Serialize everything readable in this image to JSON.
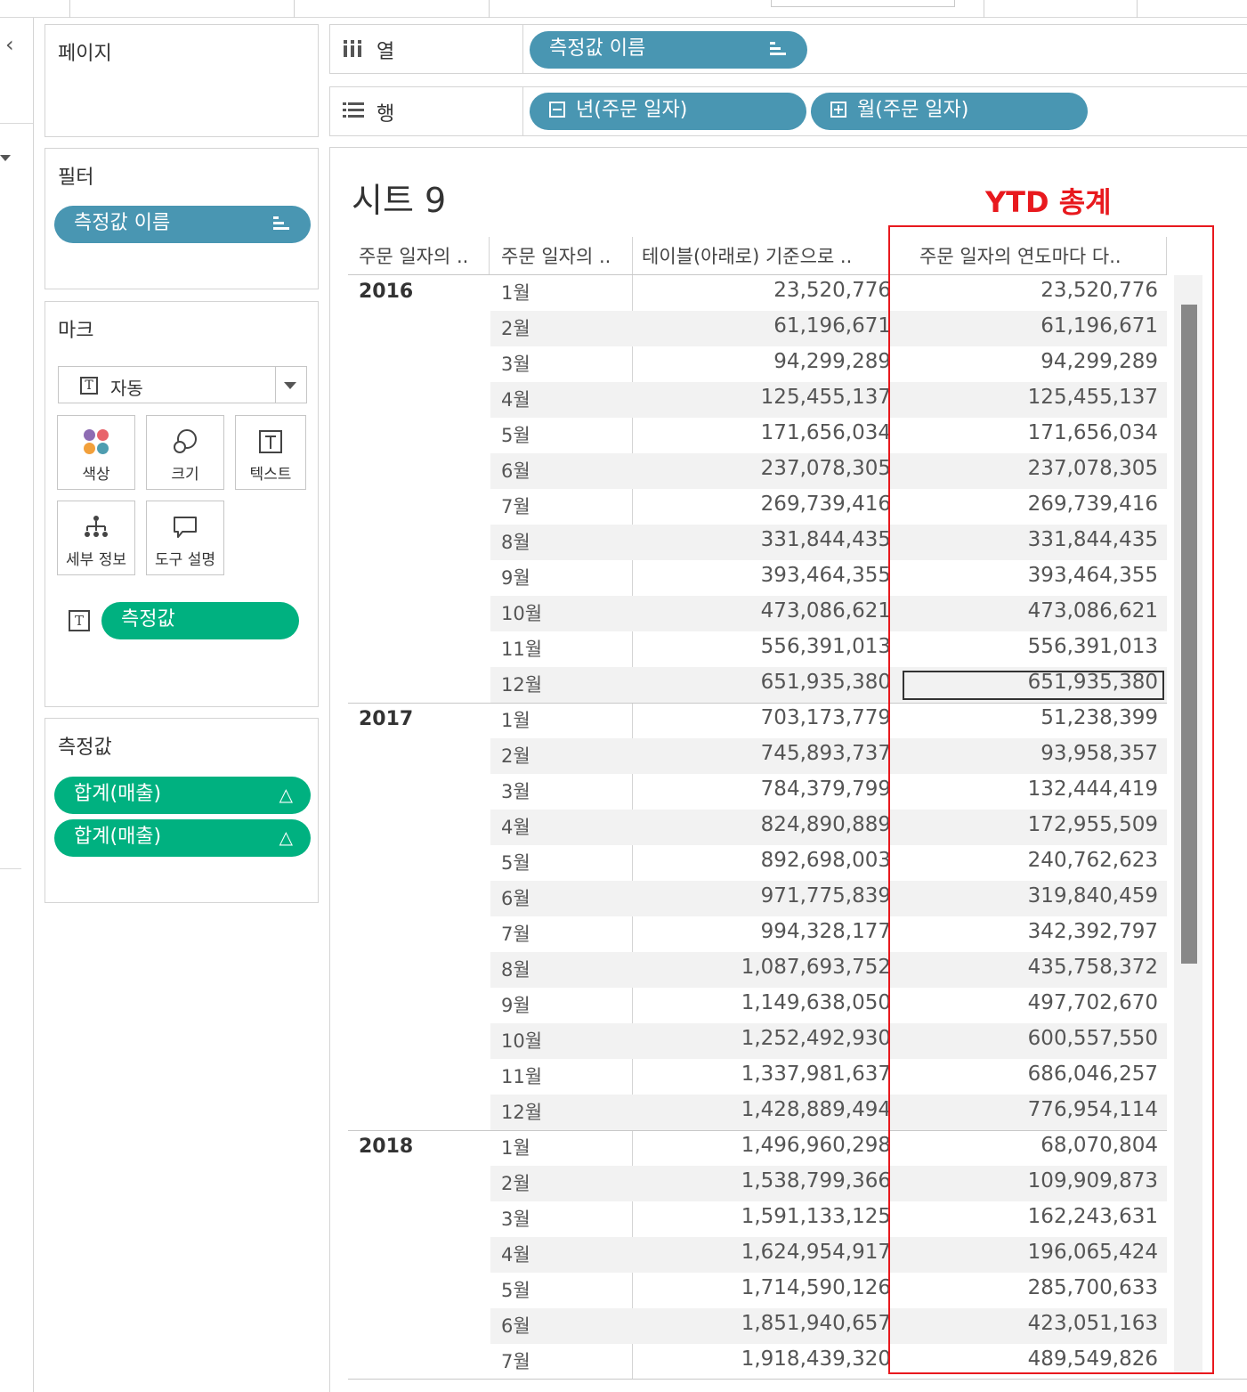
{
  "panels": {
    "pages": {
      "title": "페이지"
    },
    "filters": {
      "title": "필터",
      "pill": "측정값 이름"
    },
    "marks": {
      "title": "마크",
      "mark_type": "자동",
      "buttons": {
        "color": "색상",
        "size": "크기",
        "text": "텍스트",
        "detail": "세부 정보",
        "tooltip": "도구 설명"
      },
      "text_pill": "측정값"
    },
    "measure_values": {
      "title": "측정값",
      "pills": [
        "합계(매출)",
        "합계(매출)"
      ],
      "delta_symbol": "△"
    }
  },
  "shelves": {
    "columns": {
      "label": "열",
      "pills": [
        "측정값 이름"
      ]
    },
    "rows": {
      "label": "행",
      "pills": [
        "년(주문 일자)",
        "월(주문 일자)"
      ]
    }
  },
  "view": {
    "sheet_title": "시트 9",
    "annotation": "YTD 총계",
    "column_headers": [
      "주문 일자의 ..",
      "주문 일자의 ..",
      "테이블(아래로) 기준으로 ..",
      "주문 일자의 연도마다 다.."
    ]
  },
  "years": [
    {
      "year": "2016",
      "rows": [
        {
          "month": "1월",
          "running_total": "23,520,776",
          "ytd_total": "23,520,776"
        },
        {
          "month": "2월",
          "running_total": "61,196,671",
          "ytd_total": "61,196,671"
        },
        {
          "month": "3월",
          "running_total": "94,299,289",
          "ytd_total": "94,299,289"
        },
        {
          "month": "4월",
          "running_total": "125,455,137",
          "ytd_total": "125,455,137"
        },
        {
          "month": "5월",
          "running_total": "171,656,034",
          "ytd_total": "171,656,034"
        },
        {
          "month": "6월",
          "running_total": "237,078,305",
          "ytd_total": "237,078,305"
        },
        {
          "month": "7월",
          "running_total": "269,739,416",
          "ytd_total": "269,739,416"
        },
        {
          "month": "8월",
          "running_total": "331,844,435",
          "ytd_total": "331,844,435"
        },
        {
          "month": "9월",
          "running_total": "393,464,355",
          "ytd_total": "393,464,355"
        },
        {
          "month": "10월",
          "running_total": "473,086,621",
          "ytd_total": "473,086,621"
        },
        {
          "month": "11월",
          "running_total": "556,391,013",
          "ytd_total": "556,391,013"
        },
        {
          "month": "12월",
          "running_total": "651,935,380",
          "ytd_total": "651,935,380",
          "selected": true
        }
      ]
    },
    {
      "year": "2017",
      "rows": [
        {
          "month": "1월",
          "running_total": "703,173,779",
          "ytd_total": "51,238,399"
        },
        {
          "month": "2월",
          "running_total": "745,893,737",
          "ytd_total": "93,958,357"
        },
        {
          "month": "3월",
          "running_total": "784,379,799",
          "ytd_total": "132,444,419"
        },
        {
          "month": "4월",
          "running_total": "824,890,889",
          "ytd_total": "172,955,509"
        },
        {
          "month": "5월",
          "running_total": "892,698,003",
          "ytd_total": "240,762,623"
        },
        {
          "month": "6월",
          "running_total": "971,775,839",
          "ytd_total": "319,840,459"
        },
        {
          "month": "7월",
          "running_total": "994,328,177",
          "ytd_total": "342,392,797"
        },
        {
          "month": "8월",
          "running_total": "1,087,693,752",
          "ytd_total": "435,758,372"
        },
        {
          "month": "9월",
          "running_total": "1,149,638,050",
          "ytd_total": "497,702,670"
        },
        {
          "month": "10월",
          "running_total": "1,252,492,930",
          "ytd_total": "600,557,550"
        },
        {
          "month": "11월",
          "running_total": "1,337,981,637",
          "ytd_total": "686,046,257"
        },
        {
          "month": "12월",
          "running_total": "1,428,889,494",
          "ytd_total": "776,954,114"
        }
      ]
    },
    {
      "year": "2018",
      "rows": [
        {
          "month": "1월",
          "running_total": "1,496,960,298",
          "ytd_total": "68,070,804"
        },
        {
          "month": "2월",
          "running_total": "1,538,799,366",
          "ytd_total": "109,909,873"
        },
        {
          "month": "3월",
          "running_total": "1,591,133,125",
          "ytd_total": "162,243,631"
        },
        {
          "month": "4월",
          "running_total": "1,624,954,917",
          "ytd_total": "196,065,424"
        },
        {
          "month": "5월",
          "running_total": "1,714,590,126",
          "ytd_total": "285,700,633"
        },
        {
          "month": "6월",
          "running_total": "1,851,940,657",
          "ytd_total": "423,051,163"
        },
        {
          "month": "7월",
          "running_total": "1,918,439,320",
          "ytd_total": "489,549,826"
        }
      ]
    }
  ],
  "colors": {
    "dimension_pill": "#4996b2",
    "measure_pill": "#00b180",
    "annotation_red": "#e8191e",
    "band": "#f2f2f2"
  },
  "icons": {
    "collapse": "chevron-left-icon",
    "columns_shelf": "columns-icon",
    "rows_shelf": "rows-icon",
    "sort": "bars-icon",
    "delta": "delta-icon"
  }
}
